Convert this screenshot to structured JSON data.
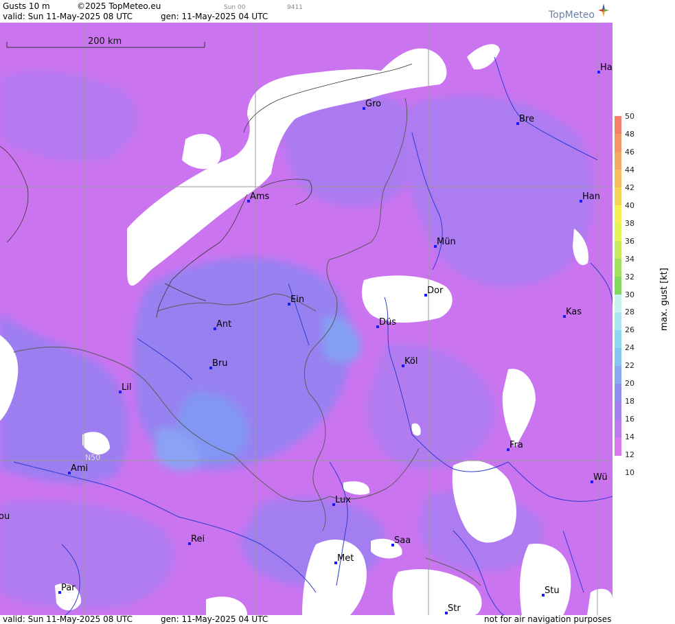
{
  "header": {
    "product": "Gusts 10 m",
    "copyright": "©2025 TopMeteo.eu",
    "run_short": "Sun 00",
    "code": "9411",
    "valid": "valid:  Sun  11-May-2025  08 UTC",
    "gen": "gen: 11-May-2025 04 UTC"
  },
  "logo": {
    "text": "TopMeteo"
  },
  "scale_bar": {
    "label": "200 km"
  },
  "graticule": {
    "lat_label": "N50"
  },
  "cities": [
    {
      "name": "Ha"
    },
    {
      "name": "Gro"
    },
    {
      "name": "Bre"
    },
    {
      "name": "Ams"
    },
    {
      "name": "Han"
    },
    {
      "name": "Mün"
    },
    {
      "name": "Dor"
    },
    {
      "name": "Ein"
    },
    {
      "name": "Kas"
    },
    {
      "name": "Ant"
    },
    {
      "name": "Düs"
    },
    {
      "name": "Bru"
    },
    {
      "name": "Köl"
    },
    {
      "name": "Lil"
    },
    {
      "name": "Fra"
    },
    {
      "name": "Ami"
    },
    {
      "name": "Wü"
    },
    {
      "name": "Lux"
    },
    {
      "name": "ou"
    },
    {
      "name": "Rei"
    },
    {
      "name": "Saa"
    },
    {
      "name": "Met"
    },
    {
      "name": "Par"
    },
    {
      "name": "Stu"
    },
    {
      "name": "Str"
    }
  ],
  "footer": {
    "valid": "valid:  Sun  11-May-2025  08 UTC",
    "gen": "gen: 11-May-2025 04 UTC",
    "disclaimer": "not for air navigation purposes"
  },
  "legend": {
    "title": "max. gust [kt]",
    "ticks": [
      "50",
      "48",
      "46",
      "44",
      "42",
      "40",
      "38",
      "36",
      "34",
      "32",
      "30",
      "28",
      "26",
      "24",
      "22",
      "20",
      "18",
      "16",
      "14",
      "12",
      "10"
    ],
    "colors": [
      "#f4806a",
      "#f49467",
      "#f5a764",
      "#f5bd5e",
      "#f6d45a",
      "#f8ef56",
      "#e6f25a",
      "#c7ea5c",
      "#a2e05e",
      "#83d861",
      "#c9f1ef",
      "#a9e6f2",
      "#8fd6f3",
      "#86c4f4",
      "#8aa8f4",
      "#8f8ef2",
      "#a47ff1",
      "#bd7af0",
      "#d877ef"
    ]
  }
}
